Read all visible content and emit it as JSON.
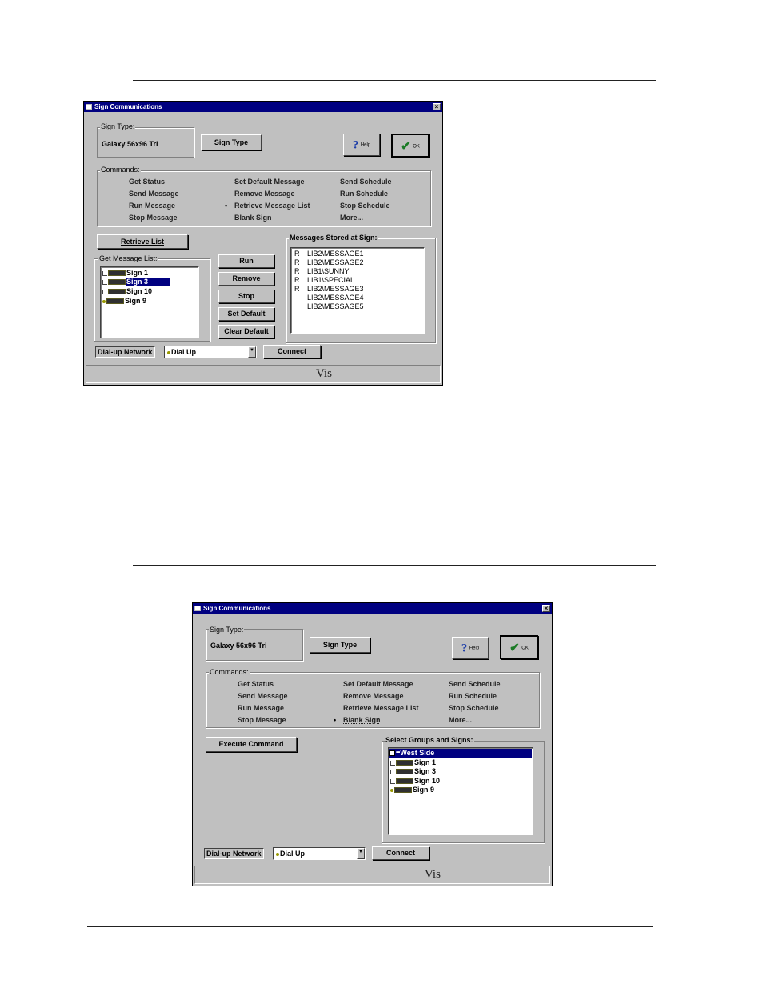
{
  "w1": {
    "title": "Sign Communications",
    "close": "×",
    "sign_type_group": "Sign Type:",
    "sign_type_value": "Galaxy 56x96 Tri",
    "sign_type_button": "Sign Type",
    "help_icon": "?",
    "help_label": "Help",
    "ok_icon": "✔",
    "ok_label": "OK",
    "commands_group": "Commands:",
    "commands": [
      "Get Status",
      "Send Message",
      "Run Message",
      "Stop Message",
      "Set Default Message",
      "Remove Message",
      "Retrieve Message List",
      "Blank Sign",
      "Send Schedule",
      "Run Schedule",
      "Stop Schedule",
      "More..."
    ],
    "bullet": "•",
    "retrieve_button": "Retrieve List",
    "get_list_group": "Get Message List:",
    "tree": [
      "Sign 1",
      "Sign 3",
      "Sign 10",
      "Sign 9"
    ],
    "side_buttons": [
      "Run",
      "Remove",
      "Stop",
      "Set Default",
      "Clear Default"
    ],
    "stored_group": "Messages Stored at Sign:",
    "messages": [
      {
        "flag": "R",
        "name": "LIB2\\MESSAGE1"
      },
      {
        "flag": "R",
        "name": "LIB2\\MESSAGE2"
      },
      {
        "flag": "R",
        "name": "LIB1\\SUNNY"
      },
      {
        "flag": "R",
        "name": "LIB1\\SPECIAL"
      },
      {
        "flag": "R",
        "name": "LIB2\\MESSAGE3"
      },
      {
        "flag": "",
        "name": "LIB2\\MESSAGE4"
      },
      {
        "flag": "",
        "name": "LIB2\\MESSAGE5"
      }
    ],
    "dialup_label": "Dial-up Network",
    "dialup_value": "Dial Up",
    "combo_arrow": "▼",
    "connect_button": "Connect",
    "vis_logo": "Vis"
  },
  "w2": {
    "title": "Sign Communications",
    "close": "×",
    "sign_type_group": "Sign Type:",
    "sign_type_value": "Galaxy 56x96 Tri",
    "sign_type_button": "Sign Type",
    "help_icon": "?",
    "help_label": "Help",
    "ok_icon": "✔",
    "ok_label": "OK",
    "commands_group": "Commands:",
    "commands": [
      "Get Status",
      "Send Message",
      "Run Message",
      "Stop Message",
      "Set Default Message",
      "Remove Message",
      "Retrieve Message List",
      "Blank Sign",
      "Send Schedule",
      "Run Schedule",
      "Stop Schedule",
      "More..."
    ],
    "bullet": "•",
    "execute_button": "Execute Command",
    "select_group": "Select Groups and Signs:",
    "tree": [
      "West Side",
      "Sign 1",
      "Sign 3",
      "Sign 10",
      "Sign 9"
    ],
    "dialup_label": "Dial-up Network",
    "dialup_value": "Dial Up",
    "combo_arrow": "▼",
    "connect_button": "Connect",
    "vis_logo": "Vis"
  }
}
